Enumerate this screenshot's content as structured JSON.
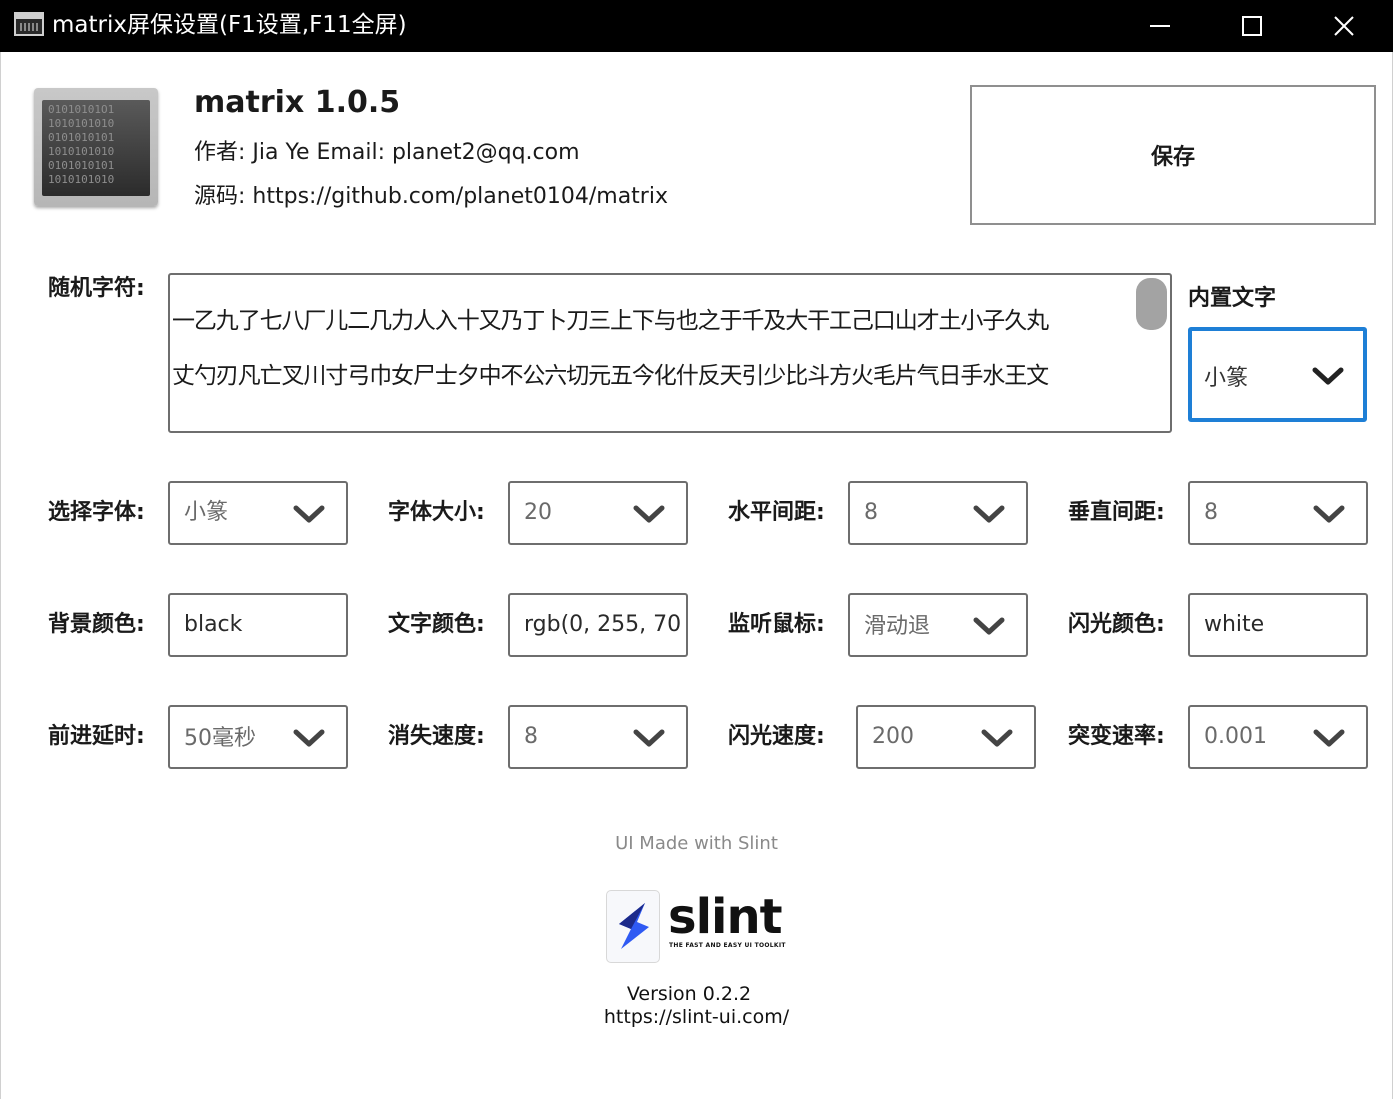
{
  "window": {
    "title": "matrix屏保设置(F1设置,F11全屏)",
    "controls": [
      "minimize",
      "maximize",
      "close"
    ]
  },
  "about": {
    "app_name": "matrix 1.0.5",
    "author_line": "作者: Jia Ye  Email: planet2@qq.com",
    "source_line": "源码: https://github.com/planet0104/matrix",
    "logo_bits": "01010101O1\n1010101010\n0101010101\n1010101010\n0101010101\n1010101010",
    "save_label": "保存"
  },
  "random_chars": {
    "label": "随机字符:",
    "line1": "一乙九了七八厂儿二几力人入十又乃丁卜刀三上下与也之于千及大干工己口山才土小子久丸",
    "line2": "丈勺刃凡亡叉川寸弓巾女尸士夕中不公六切元五今化什反天引少比斗方火毛片气日手水王文"
  },
  "builtin": {
    "title": "内置文字",
    "value": "小篆"
  },
  "settings": {
    "font_label": "选择字体:",
    "font_value": "小篆",
    "size_label": "字体大小:",
    "size_value": "20",
    "hspace_label": "水平间距:",
    "hspace_value": "8",
    "vspace_label": "垂直间距:",
    "vspace_value": "8",
    "bg_label": "背景颜色:",
    "bg_value": "black",
    "text_color_label": "文字颜色:",
    "text_color_value": "rgb(0, 255, 70",
    "mouse_label": "监听鼠标:",
    "mouse_value": "滑动退",
    "flash_color_label": "闪光颜色:",
    "flash_color_value": "white",
    "delay_label": "前进延时:",
    "delay_value": "50毫秒",
    "fade_label": "消失速度:",
    "fade_value": "8",
    "flash_speed_label": "闪光速度:",
    "flash_speed_value": "200",
    "mutation_label": "突变速率:",
    "mutation_value": "0.001"
  },
  "footer": {
    "made_with": "UI Made with Slint",
    "slint_word": "slint",
    "slint_tagline": "THE FAST AND EASY UI TOOLKIT",
    "version": "Version 0.2.2",
    "site": "https://slint-ui.com/"
  },
  "colors": {
    "focus_accent": "#1e7fd6",
    "slint_blue": "#2f5af3",
    "titlebar": "#000000"
  }
}
